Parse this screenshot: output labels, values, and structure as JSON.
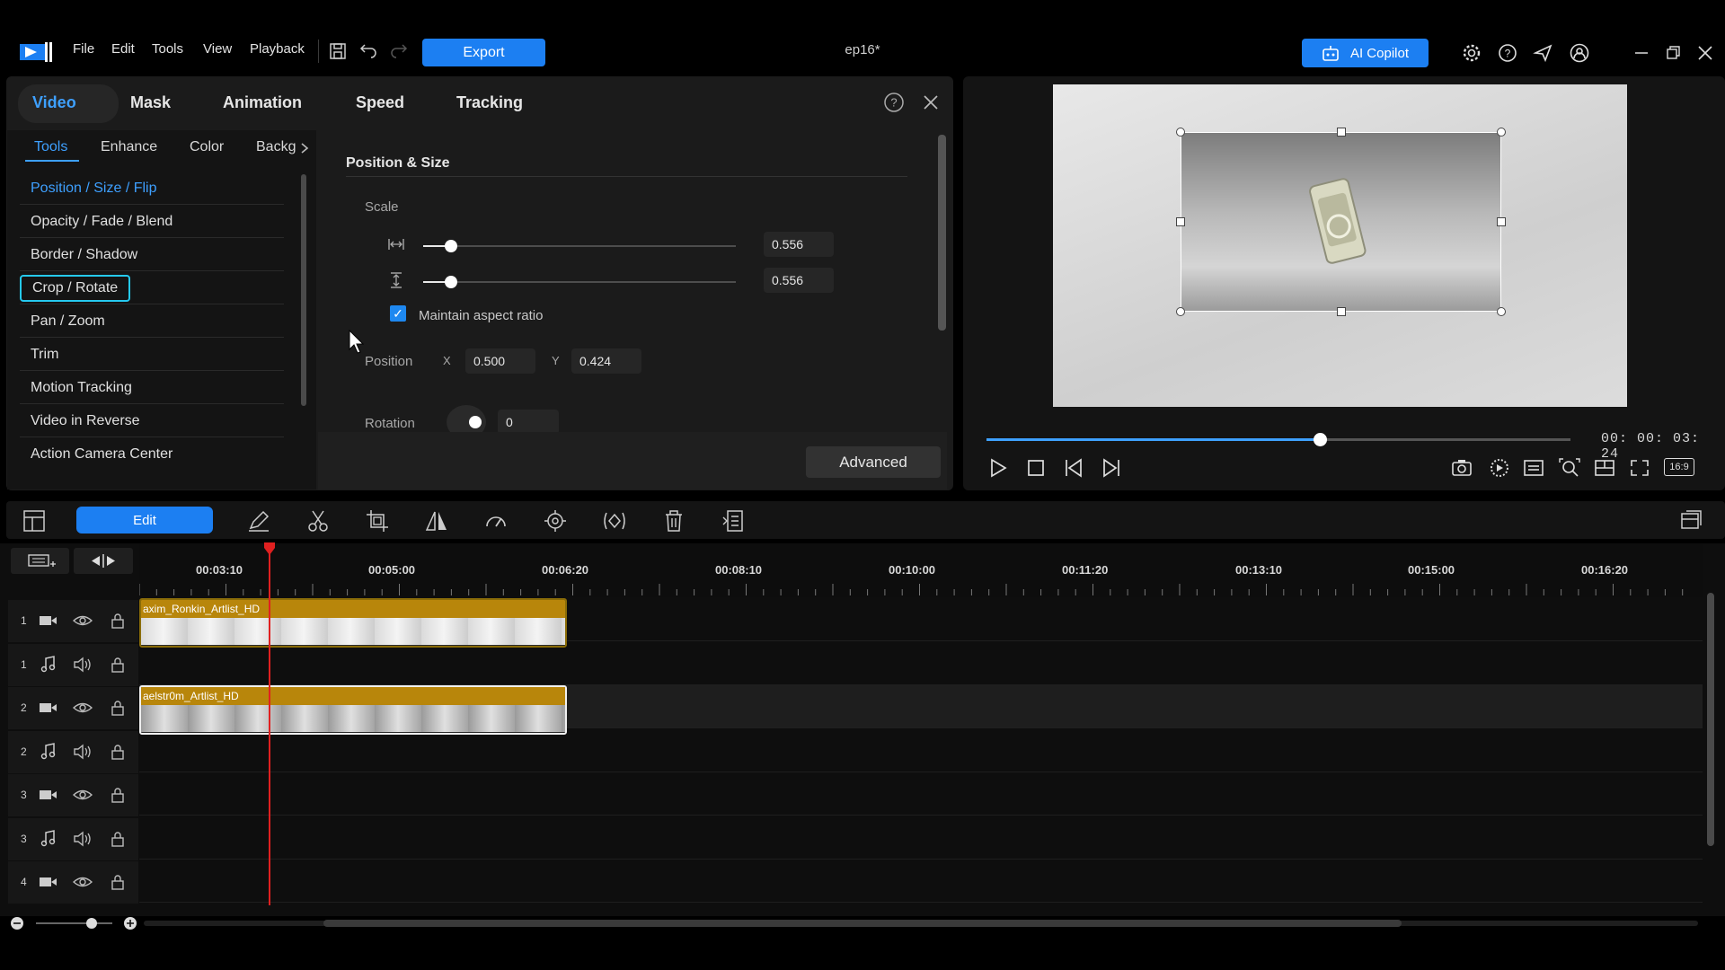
{
  "app": {
    "menu": [
      "File",
      "Edit",
      "Tools",
      "View",
      "Playback"
    ],
    "export_label": "Export",
    "project_title": "ep16*",
    "copilot_label": "AI Copilot"
  },
  "editor": {
    "tabs": [
      "Video",
      "Mask",
      "Animation",
      "Speed",
      "Tracking"
    ],
    "active_tab": "Video",
    "subtabs": [
      "Tools",
      "Enhance",
      "Color",
      "Backg"
    ],
    "active_subtab": "Tools",
    "tools": [
      "Position / Size / Flip",
      "Opacity / Fade / Blend",
      "Border / Shadow",
      "Crop / Rotate",
      "Pan / Zoom",
      "Trim",
      "Motion Tracking",
      "Video in Reverse",
      "Action Camera Center"
    ],
    "active_tool": "Position / Size / Flip",
    "highlighted_tool": "Crop / Rotate",
    "section_title": "Position & Size",
    "scale_label": "Scale",
    "scale_width": "0.556",
    "scale_height": "0.556",
    "maintain_aspect_label": "Maintain aspect ratio",
    "maintain_aspect_checked": true,
    "position_label": "Position",
    "x_label": "X",
    "x_value": "0.500",
    "y_label": "Y",
    "y_value": "0.424",
    "rotation_label": "Rotation",
    "rotation_value": "0",
    "advanced_label": "Advanced"
  },
  "preview": {
    "timecode": "00: 00: 03: 24",
    "seek_progress": 0.57,
    "aspect_label": "16:9"
  },
  "timeline": {
    "edit_label": "Edit",
    "ruler": [
      "00:03:10",
      "00:05:00",
      "00:06:20",
      "00:08:10",
      "00:10:00",
      "00:11:20",
      "00:13:10",
      "00:15:00",
      "00:16:20"
    ],
    "tracks": [
      {
        "num": "1",
        "type": "video"
      },
      {
        "num": "1",
        "type": "audio"
      },
      {
        "num": "2",
        "type": "video"
      },
      {
        "num": "2",
        "type": "audio"
      },
      {
        "num": "3",
        "type": "video"
      },
      {
        "num": "3",
        "type": "audio"
      },
      {
        "num": "4",
        "type": "video"
      }
    ],
    "clips": [
      {
        "label": "axim_Ronkin_Artlist_HD",
        "track": "1"
      },
      {
        "label": "aelstr0m_Artlist_HD",
        "track": "2"
      }
    ]
  },
  "colors": {
    "accent": "#1c7ff2",
    "active_text": "#3ea0ff",
    "highlight_border": "#25c9ef",
    "clip_border": "#c59a0c",
    "playhead": "#e02020"
  }
}
